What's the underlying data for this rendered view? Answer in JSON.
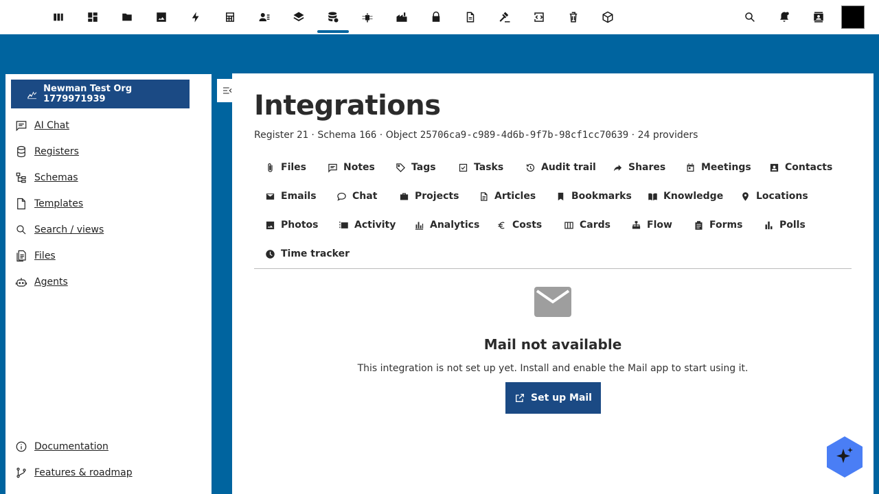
{
  "topbar": {
    "apps": [
      {
        "icon": "columns-icon",
        "label": "Apps"
      },
      {
        "icon": "dashboard-icon",
        "label": "Dashboard"
      },
      {
        "icon": "folder-icon",
        "label": "Files"
      },
      {
        "icon": "image-icon",
        "label": "Photos"
      },
      {
        "icon": "bolt-icon",
        "label": "Activity"
      },
      {
        "icon": "calculator-icon",
        "label": "Calculator"
      },
      {
        "icon": "contacts-icon",
        "label": "Contacts"
      },
      {
        "icon": "layers-icon",
        "label": "Layers"
      },
      {
        "icon": "database-settings-icon",
        "label": "Registers",
        "active": true
      },
      {
        "icon": "bug-icon",
        "label": "Bug"
      },
      {
        "icon": "factory-icon",
        "label": "Factory"
      },
      {
        "icon": "lock-icon",
        "label": "Lock"
      },
      {
        "icon": "document-icon",
        "label": "Document"
      },
      {
        "icon": "gavel-icon",
        "label": "Gavel"
      },
      {
        "icon": "code-tag-icon",
        "label": "Code"
      },
      {
        "icon": "trash-icon",
        "label": "Trash"
      },
      {
        "icon": "cube-icon",
        "label": "Cube"
      }
    ],
    "right": [
      {
        "icon": "search-icon"
      },
      {
        "icon": "notifications-icon"
      },
      {
        "icon": "contacts-book-icon"
      }
    ]
  },
  "sidebar": {
    "org_label": "Newman Test Org 1779971939",
    "items": [
      {
        "label": "AI Chat",
        "icon": "chat-icon"
      },
      {
        "label": "Registers",
        "icon": "database-icon"
      },
      {
        "label": "Schemas",
        "icon": "hierarchy-icon"
      },
      {
        "label": "Templates",
        "icon": "file-icon"
      },
      {
        "label": "Search / views",
        "icon": "search-icon"
      },
      {
        "label": "Files",
        "icon": "files-icon"
      },
      {
        "label": "Agents",
        "icon": "robot-icon"
      }
    ],
    "footer": [
      {
        "label": "Documentation",
        "icon": "info-icon"
      },
      {
        "label": "Features & roadmap",
        "icon": "roadmap-icon"
      }
    ]
  },
  "main": {
    "title": "Integrations",
    "meta": {
      "register_label": "Register",
      "register_id": "21",
      "schema_label": "Schema",
      "schema_id": "166",
      "object_label": "Object",
      "object_id": "25706ca9-c989-4d6b-9f7b-98cf1cc70639",
      "providers": "24 providers"
    },
    "tabs": [
      {
        "label": "Files",
        "icon": "paperclip-icon"
      },
      {
        "label": "Notes",
        "icon": "note-icon"
      },
      {
        "label": "Tags",
        "icon": "tag-icon"
      },
      {
        "label": "Tasks",
        "icon": "checkbox-icon"
      },
      {
        "label": "Audit trail",
        "icon": "history-icon"
      },
      {
        "label": "Shares",
        "icon": "share-icon"
      },
      {
        "label": "Meetings",
        "icon": "calendar-icon"
      },
      {
        "label": "Contacts",
        "icon": "contact-card-icon"
      },
      {
        "label": "Emails",
        "icon": "mail-icon"
      },
      {
        "label": "Chat",
        "icon": "chat-bubble-icon"
      },
      {
        "label": "Projects",
        "icon": "briefcase-icon"
      },
      {
        "label": "Articles",
        "icon": "article-icon"
      },
      {
        "label": "Bookmarks",
        "icon": "bookmark-icon"
      },
      {
        "label": "Knowledge",
        "icon": "book-icon"
      },
      {
        "label": "Locations",
        "icon": "pin-icon"
      },
      {
        "label": "Photos",
        "icon": "photo-icon"
      },
      {
        "label": "Activity",
        "icon": "timeline-icon"
      },
      {
        "label": "Analytics",
        "icon": "bar-chart-icon"
      },
      {
        "label": "Costs",
        "icon": "euro-icon"
      },
      {
        "label": "Cards",
        "icon": "columns-icon"
      },
      {
        "label": "Flow",
        "icon": "sitemap-icon"
      },
      {
        "label": "Forms",
        "icon": "clipboard-icon"
      },
      {
        "label": "Polls",
        "icon": "poll-icon"
      },
      {
        "label": "Time tracker",
        "icon": "clock-icon"
      }
    ],
    "empty": {
      "icon": "mail-icon",
      "title": "Mail not available",
      "description": "This integration is not set up yet. Install and enable the Mail app to start using it.",
      "button": "Set up Mail"
    }
  },
  "fab": {
    "icon": "sparkle-icon"
  },
  "colors": {
    "accent": "#00649f",
    "button": "#1b4a84",
    "fab": "#4a7ef5"
  }
}
